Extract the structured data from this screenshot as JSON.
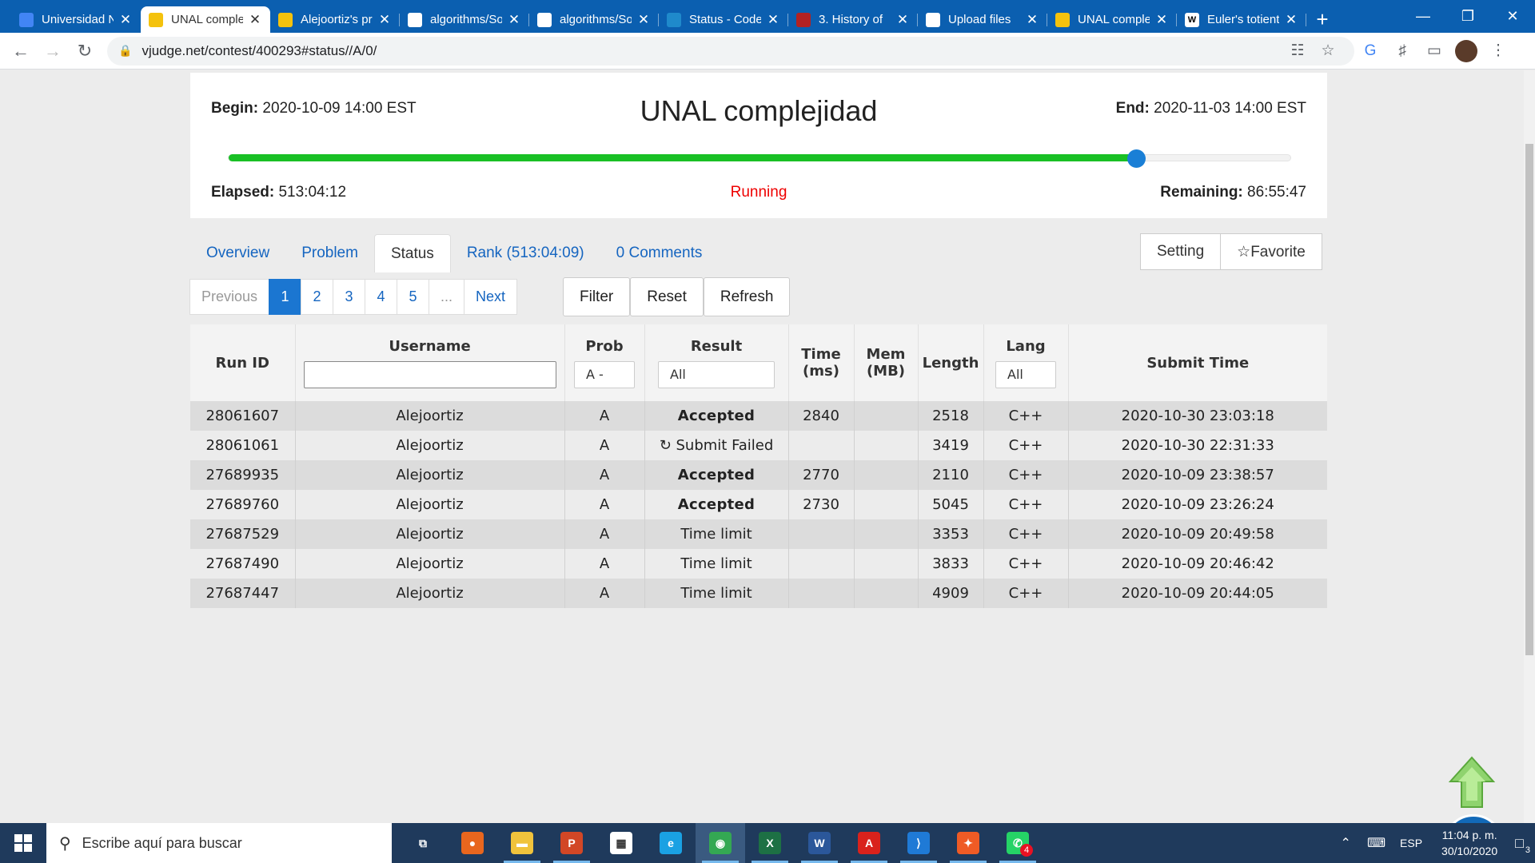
{
  "browser": {
    "tabs": [
      {
        "title": "Universidad Nacional",
        "icon": "calendar-icon",
        "color": "#4285f4",
        "active": false
      },
      {
        "title": "UNAL complejidad",
        "icon": "vjudge-icon",
        "color": "#f4c20d",
        "active": true
      },
      {
        "title": "Alejoortiz's profile",
        "icon": "vjudge-icon",
        "color": "#f4c20d",
        "active": false
      },
      {
        "title": "algorithms/Solutions",
        "icon": "github-icon",
        "color": "#ffffff",
        "active": false
      },
      {
        "title": "algorithms/Solutions",
        "icon": "github-icon",
        "color": "#ffffff",
        "active": false
      },
      {
        "title": "Status - Codeforces",
        "icon": "codeforces-icon",
        "color": "#1f8acb",
        "active": false
      },
      {
        "title": "3. History of",
        "icon": "book-icon",
        "color": "#b22222",
        "active": false
      },
      {
        "title": "Upload files",
        "icon": "github-icon",
        "color": "#ffffff",
        "active": false
      },
      {
        "title": "UNAL complejidad",
        "icon": "vjudge-icon",
        "color": "#f4c20d",
        "active": false
      },
      {
        "title": "Euler's totient",
        "icon": "wikipedia-icon",
        "color": "#ffffff",
        "active": false
      }
    ],
    "url": "vjudge.net/contest/400293#status//A/0/"
  },
  "contest": {
    "begin_label": "Begin:",
    "begin_value": "2020-10-09 14:00 EST",
    "title": "UNAL complejidad",
    "end_label": "End:",
    "end_value": "2020-11-03 14:00 EST",
    "progress": 0.855,
    "elapsed_label": "Elapsed:",
    "elapsed_value": "513:04:12",
    "status": "Running",
    "remaining_label": "Remaining:",
    "remaining_value": "86:55:47"
  },
  "nav": {
    "tabs": [
      "Overview",
      "Problem",
      "Status",
      "Rank (513:04:09)",
      "0 Comments"
    ],
    "active_tab": "Status",
    "setting": "Setting",
    "favorite": "☆Favorite"
  },
  "pagination": {
    "previous": "Previous",
    "pages": [
      "1",
      "2",
      "3",
      "4",
      "5",
      "..."
    ],
    "active_page": "1",
    "next": "Next"
  },
  "actions": {
    "filter": "Filter",
    "reset": "Reset",
    "refresh": "Refresh"
  },
  "table": {
    "headers": {
      "run_id": "Run ID",
      "username": "Username",
      "prob": "Prob",
      "result": "Result",
      "time": "Time (ms)",
      "mem": "Mem (MB)",
      "length": "Length",
      "lang": "Lang",
      "submit_time": "Submit Time"
    },
    "filters": {
      "username": "",
      "prob": "A -",
      "result": "All",
      "lang": "All"
    },
    "rows": [
      {
        "run_id": "28061607",
        "user": "Alejoortiz",
        "prob": "A",
        "result": "Accepted",
        "kind": "accepted",
        "time": "2840",
        "mem": "",
        "length": "2518",
        "lang": "C++",
        "submit": "2020-10-30 23:03:18"
      },
      {
        "run_id": "28061061",
        "user": "Alejoortiz",
        "prob": "A",
        "result": "↻ Submit Failed",
        "kind": "failed",
        "time": "",
        "mem": "",
        "length": "3419",
        "lang": "C++",
        "submit": "2020-10-30 22:31:33"
      },
      {
        "run_id": "27689935",
        "user": "Alejoortiz",
        "prob": "A",
        "result": "Accepted",
        "kind": "accepted",
        "time": "2770",
        "mem": "",
        "length": "2110",
        "lang": "C++",
        "submit": "2020-10-09 23:38:57"
      },
      {
        "run_id": "27689760",
        "user": "Alejoortiz",
        "prob": "A",
        "result": "Accepted",
        "kind": "accepted",
        "time": "2730",
        "mem": "",
        "length": "5045",
        "lang": "C++",
        "submit": "2020-10-09 23:26:24"
      },
      {
        "run_id": "27687529",
        "user": "Alejoortiz",
        "prob": "A",
        "result": "Time limit",
        "kind": "tle",
        "time": "",
        "mem": "",
        "length": "3353",
        "lang": "C++",
        "submit": "2020-10-09 20:49:58"
      },
      {
        "run_id": "27687490",
        "user": "Alejoortiz",
        "prob": "A",
        "result": "Time limit",
        "kind": "tle",
        "time": "",
        "mem": "",
        "length": "3833",
        "lang": "C++",
        "submit": "2020-10-09 20:46:42"
      },
      {
        "run_id": "27687447",
        "user": "Alejoortiz",
        "prob": "A",
        "result": "Time limit",
        "kind": "tle",
        "time": "",
        "mem": "",
        "length": "4909",
        "lang": "C++",
        "submit": "2020-10-09 20:44:05"
      }
    ]
  },
  "taskbar": {
    "search_placeholder": "Escribe aquí para buscar",
    "apps": [
      {
        "name": "task-view-icon",
        "color": "#1f3a5c",
        "glyph": "⧉"
      },
      {
        "name": "firefox-icon",
        "color": "#e8661e",
        "glyph": "●"
      },
      {
        "name": "file-explorer-icon",
        "color": "#f0c33c",
        "glyph": "▬"
      },
      {
        "name": "powerpoint-icon",
        "color": "#d24726",
        "glyph": "P"
      },
      {
        "name": "store-icon",
        "color": "#ffffff",
        "glyph": "▦"
      },
      {
        "name": "edge-icon",
        "color": "#1aa1e3",
        "glyph": "e"
      },
      {
        "name": "chrome-icon",
        "color": "#34a853",
        "glyph": "◉"
      },
      {
        "name": "excel-icon",
        "color": "#1d7044",
        "glyph": "X"
      },
      {
        "name": "word-icon",
        "color": "#2b579a",
        "glyph": "W"
      },
      {
        "name": "acrobat-icon",
        "color": "#d9221c",
        "glyph": "A"
      },
      {
        "name": "vscode-icon",
        "color": "#1f7ad6",
        "glyph": "⟩"
      },
      {
        "name": "postman-icon",
        "color": "#ef5b25",
        "glyph": "✦"
      },
      {
        "name": "whatsapp-icon",
        "color": "#25d366",
        "glyph": "✆"
      }
    ],
    "whatsapp_badge": "4",
    "language": "ESP",
    "time": "11:04 p. m.",
    "date": "30/10/2020",
    "notifications": "3"
  }
}
